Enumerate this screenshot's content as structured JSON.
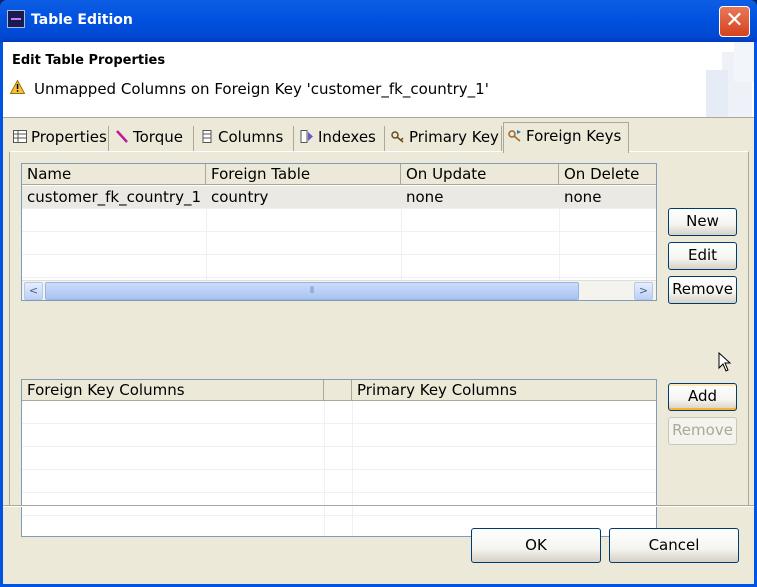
{
  "window": {
    "title": "Table Edition"
  },
  "header": {
    "title": "Edit Table Properties",
    "message": "Unmapped Columns on Foreign Key 'customer_fk_country_1'"
  },
  "tabs": [
    {
      "label": "Properties",
      "icon": "table-icon"
    },
    {
      "label": "Torque",
      "icon": "pencil-icon"
    },
    {
      "label": "Columns",
      "icon": "columns-icon"
    },
    {
      "label": "Indexes",
      "icon": "index-icon"
    },
    {
      "label": "Primary Key",
      "icon": "key-icon"
    },
    {
      "label": "Foreign Keys",
      "icon": "foreign-key-icon",
      "active": true
    }
  ],
  "fk_table": {
    "columns": [
      "Name",
      "Foreign Table",
      "On Update",
      "On Delete"
    ],
    "rows": [
      [
        "customer_fk_country_1",
        "country",
        "none",
        "none"
      ]
    ]
  },
  "fk_buttons": {
    "new": "New",
    "edit": "Edit",
    "remove": "Remove"
  },
  "cols_table": {
    "columns": [
      "Foreign Key Columns",
      "",
      "Primary Key Columns"
    ]
  },
  "cols_buttons": {
    "add": "Add",
    "remove": "Remove"
  },
  "footer": {
    "ok": "OK",
    "cancel": "Cancel"
  },
  "colors": {
    "titlebar": "#0054e3",
    "dialog": "#ece9d8",
    "border": "#7f9db9"
  }
}
